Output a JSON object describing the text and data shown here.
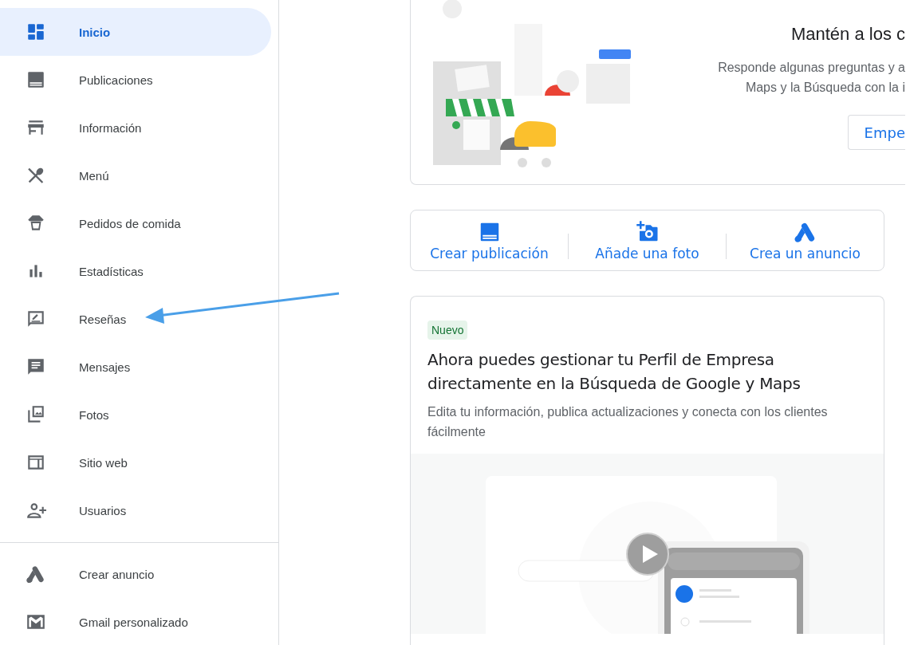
{
  "sidebar": {
    "items": [
      {
        "label": "Inicio",
        "kind": "dashboard",
        "selected": true
      },
      {
        "label": "Publicaciones",
        "kind": "article",
        "selected": false
      },
      {
        "label": "Información",
        "kind": "storefront",
        "selected": false
      },
      {
        "label": "Menú",
        "kind": "utensils",
        "selected": false
      },
      {
        "label": "Pedidos de comida",
        "kind": "takeout",
        "selected": false
      },
      {
        "label": "Estadísticas",
        "kind": "bar_chart",
        "selected": false
      },
      {
        "label": "Reseñas",
        "kind": "review",
        "selected": false
      },
      {
        "label": "Mensajes",
        "kind": "message",
        "selected": false
      },
      {
        "label": "Fotos",
        "kind": "photos",
        "selected": false
      },
      {
        "label": "Sitio web",
        "kind": "web",
        "selected": false
      },
      {
        "label": "Usuarios",
        "kind": "add_person",
        "selected": false
      }
    ],
    "footer_items": [
      {
        "label": "Crear anuncio",
        "kind": "ads",
        "selected": false
      },
      {
        "label": "Gmail personalizado",
        "kind": "mail",
        "selected": false
      }
    ]
  },
  "setup_card": {
    "title": "Mantén a los c",
    "lines": [
      "Responde algunas preguntas y a",
      "Maps y la Búsqueda con la i"
    ],
    "button": "Empe"
  },
  "quick_actions": [
    {
      "label": "Crear publicación",
      "kind": "article"
    },
    {
      "label": "Añade una foto",
      "kind": "add_photo"
    },
    {
      "label": "Crea un anuncio",
      "kind": "ads"
    }
  ],
  "news_card": {
    "badge": "Nuevo",
    "title": "Ahora puedes gestionar tu Perfil de Empresa directamente en la Búsqueda de Google y Maps",
    "description": "Edita tu información, publica actualizaciones y conecta con los clientes fácilmente"
  }
}
